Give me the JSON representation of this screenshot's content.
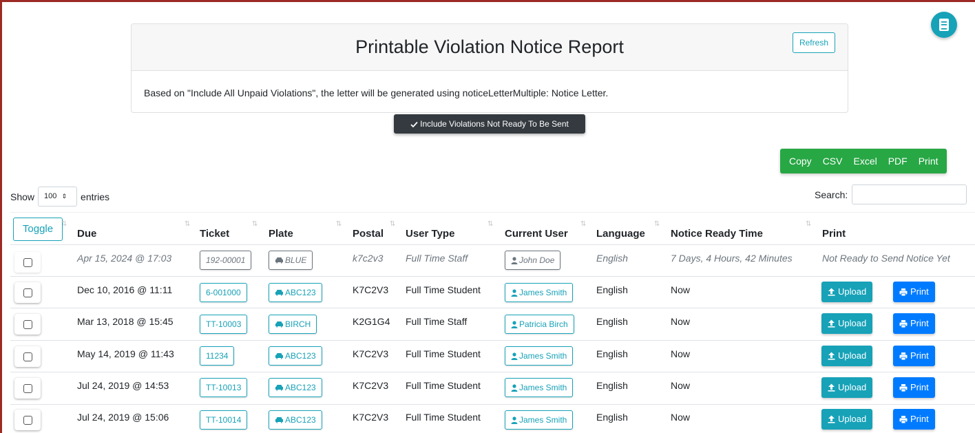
{
  "report": {
    "title": "Printable Violation Notice Report",
    "refresh_label": "Refresh",
    "description": "Based on \"Include All Unpaid Violations\", the letter will be generated using noticeLetterMultiple: Notice Letter."
  },
  "include_toggle": {
    "label": "Include Violations Not Ready To Be Sent",
    "icon": "check-icon"
  },
  "export_buttons": [
    "Copy",
    "CSV",
    "Excel",
    "PDF",
    "Print"
  ],
  "length_menu": {
    "prefix": "Show",
    "value": "100",
    "suffix": "entries"
  },
  "search": {
    "label": "Search:",
    "value": ""
  },
  "table": {
    "toggle_label": "Toggle",
    "columns": [
      "Due",
      "Ticket",
      "Plate",
      "Postal",
      "User Type",
      "Current User",
      "Language",
      "Notice Ready Time",
      "Print"
    ],
    "rows": [
      {
        "due": "Apr 15, 2024 @ 17:03",
        "ticket": "192-00001",
        "plate": "BLUE",
        "postal": "k7c2v3",
        "user_type": "Full Time Staff",
        "user": "John Doe",
        "language": "English",
        "ready": "7 Days, 4 Hours, 42 Minutes",
        "print_status": "Not Ready to Send Notice Yet"
      },
      {
        "due": "Dec 10, 2016 @ 11:11",
        "ticket": "6-001000",
        "plate": "ABC123",
        "postal": "K7C2V3",
        "user_type": "Full Time Student",
        "user": "James Smith",
        "language": "English",
        "ready": "Now"
      },
      {
        "due": "Mar 13, 2018 @ 15:45",
        "ticket": "TT-10003",
        "plate": "BIRCH",
        "postal": "K2G1G4",
        "user_type": "Full Time Staff",
        "user": "Patricia Birch",
        "language": "English",
        "ready": "Now"
      },
      {
        "due": "May 14, 2019 @ 11:43",
        "ticket": "11234",
        "plate": "ABC123",
        "postal": "K7C2V3",
        "user_type": "Full Time Student",
        "user": "James Smith",
        "language": "English",
        "ready": "Now"
      },
      {
        "due": "Jul 24, 2019 @ 14:53",
        "ticket": "TT-10013",
        "plate": "ABC123",
        "postal": "K7C2V3",
        "user_type": "Full Time Student",
        "user": "James Smith",
        "language": "English",
        "ready": "Now"
      },
      {
        "due": "Jul 24, 2019 @ 15:06",
        "ticket": "TT-10014",
        "plate": "ABC123",
        "postal": "K7C2V3",
        "user_type": "Full Time Student",
        "user": "James Smith",
        "language": "English",
        "ready": "Now"
      }
    ],
    "upload_label": "Upload",
    "print_label": "Print"
  },
  "colors": {
    "frame": "#9c2a24",
    "teal": "#17a2b8",
    "blue": "#007bff",
    "green": "#28a745",
    "dark": "#343a40"
  }
}
